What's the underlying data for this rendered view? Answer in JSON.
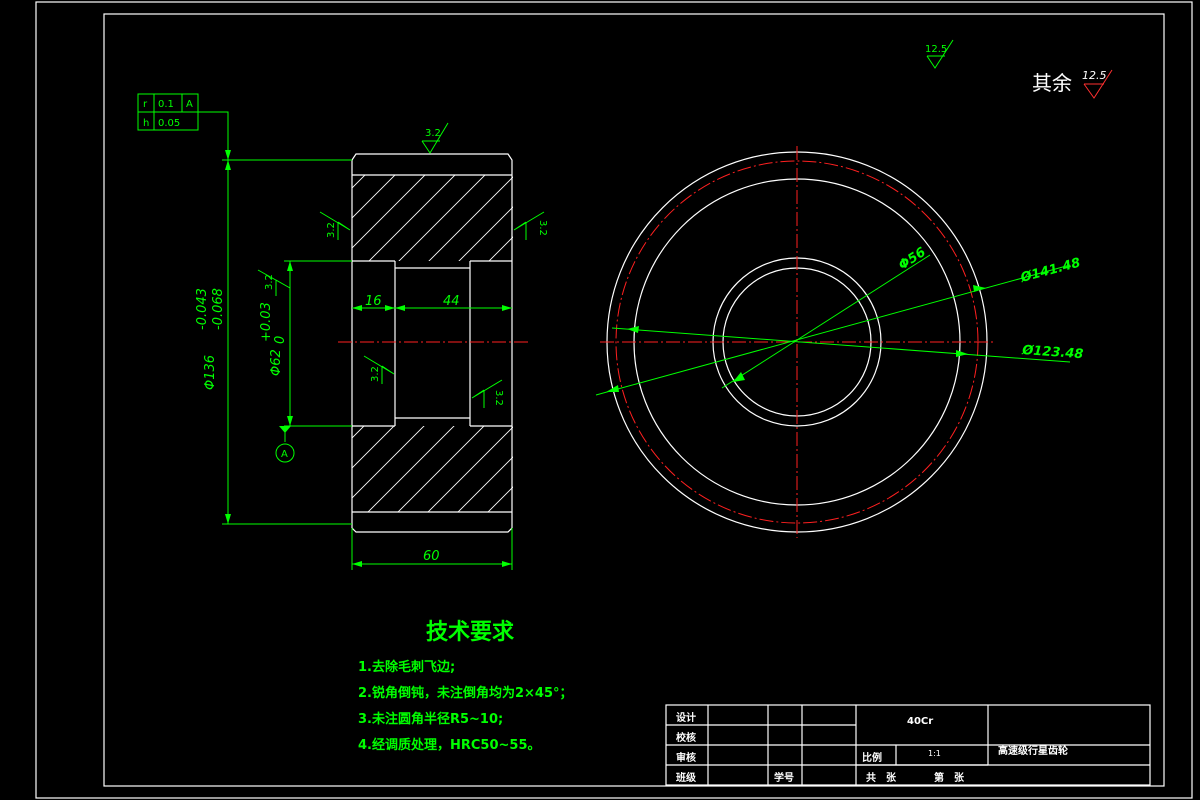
{
  "roughness": {
    "top_symbol": "12.5",
    "other_label": "其余",
    "other_value": "12.5",
    "face_top": "3.2",
    "face_left": "3.2",
    "face_right": "3.2",
    "bore_left": "3.2",
    "bore_inner": "3.2",
    "bore_right": "3.2"
  },
  "tolerance_frame": {
    "rows": [
      {
        "sym": "r",
        "val": "0.1",
        "datum": "A"
      },
      {
        "sym": "h",
        "val": "0.05",
        "datum": ""
      }
    ]
  },
  "datum_label": "A",
  "dimensions": {
    "outer_dia": "Φ136",
    "outer_dev_upper": "-0.043",
    "outer_dev_lower": "-0.068",
    "bore_dia": "Φ62",
    "bore_dev_upper": "+0.03",
    "bore_dev_lower": "0",
    "len_16": "16",
    "len_44": "44",
    "width_60": "60",
    "dia_56": "Φ56",
    "dia_141": "Ø141.48",
    "dia_123": "Ø123.48"
  },
  "technical_requirements": {
    "title": "技术要求",
    "items": [
      "1.去除毛刺飞边;",
      "2.锐角倒钝，未注倒角均为2×45°；",
      "3.未注圆角半径R5~10;",
      "4.经调质处理，HRC50~55。"
    ]
  },
  "title_block": {
    "design": "设计",
    "check": "校核",
    "review": "审核",
    "class": "班级",
    "student_id": "学号",
    "material": "40Cr",
    "scale_label": "比例",
    "scale_value": "1:1",
    "part_name": "高速级行星齿轮",
    "total_sheets": "共　张",
    "sheet_no": "第　张"
  }
}
